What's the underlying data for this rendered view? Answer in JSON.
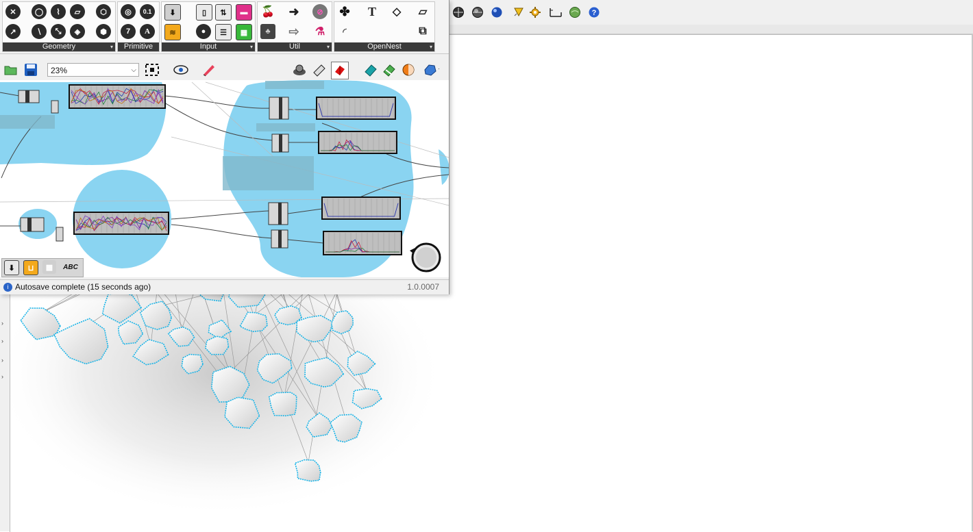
{
  "ribbon": {
    "groups": [
      {
        "label": "Geometry",
        "icons": [
          "point-icon",
          "circle-icon",
          "curve-icon",
          "surface-icon",
          "box-icon",
          "vector-icon",
          "line-icon",
          "polyline-icon",
          "mesh-icon",
          "brep-icon"
        ]
      },
      {
        "label": "Primitive",
        "number_icon": "0.1",
        "integer_icon": "7",
        "text_icon": "A"
      },
      {
        "label": "Input",
        "icons": [
          "data-input-icon",
          "toggle-icon",
          "slider-icon",
          "swatch-icon",
          "panel-icon",
          "button-icon",
          "list-icon",
          "gradient-icon"
        ]
      },
      {
        "label": "Util",
        "icons": [
          "cherry-icon",
          "arrow-right-icon",
          "ellipse-icon",
          "tree-icon",
          "arrow-outline-icon",
          "flask-icon"
        ]
      },
      {
        "label": "OpenNest",
        "icons": [
          "nest-icon",
          "text-t-icon",
          "tag-icon",
          "sheet-icon",
          "signal-icon",
          "shapes-icon"
        ]
      }
    ]
  },
  "toolbar": {
    "zoom_value": "23%",
    "icons": [
      "open-file-icon",
      "save-icon",
      "zoom-extents-icon",
      "preview-eye-icon",
      "sketch-pen-icon",
      "bake-icon",
      "shaded-preview-icon",
      "mesh-preview-icon",
      "sphere-icon"
    ]
  },
  "canvas_bottom_icons": [
    "download-icon",
    "wire-display-icon",
    "checker-icon",
    "spell-check-icon"
  ],
  "status": {
    "message": "Autosave complete (15 seconds ago)",
    "version": "1.0.0007"
  },
  "colors": {
    "group_blue": "#8ad4f1",
    "rock_blue": "#4a88d8",
    "outline_cyan": "#18b4e8",
    "ribbon_caption": "#3a3a3a"
  },
  "rhino_toolbar_icons": [
    "render-sphere-icon",
    "shaded-sphere-icon",
    "blue-sphere-icon",
    "spotlight-icon",
    "gear-icon",
    "dimension-icon",
    "globe-icon",
    "help-icon"
  ]
}
